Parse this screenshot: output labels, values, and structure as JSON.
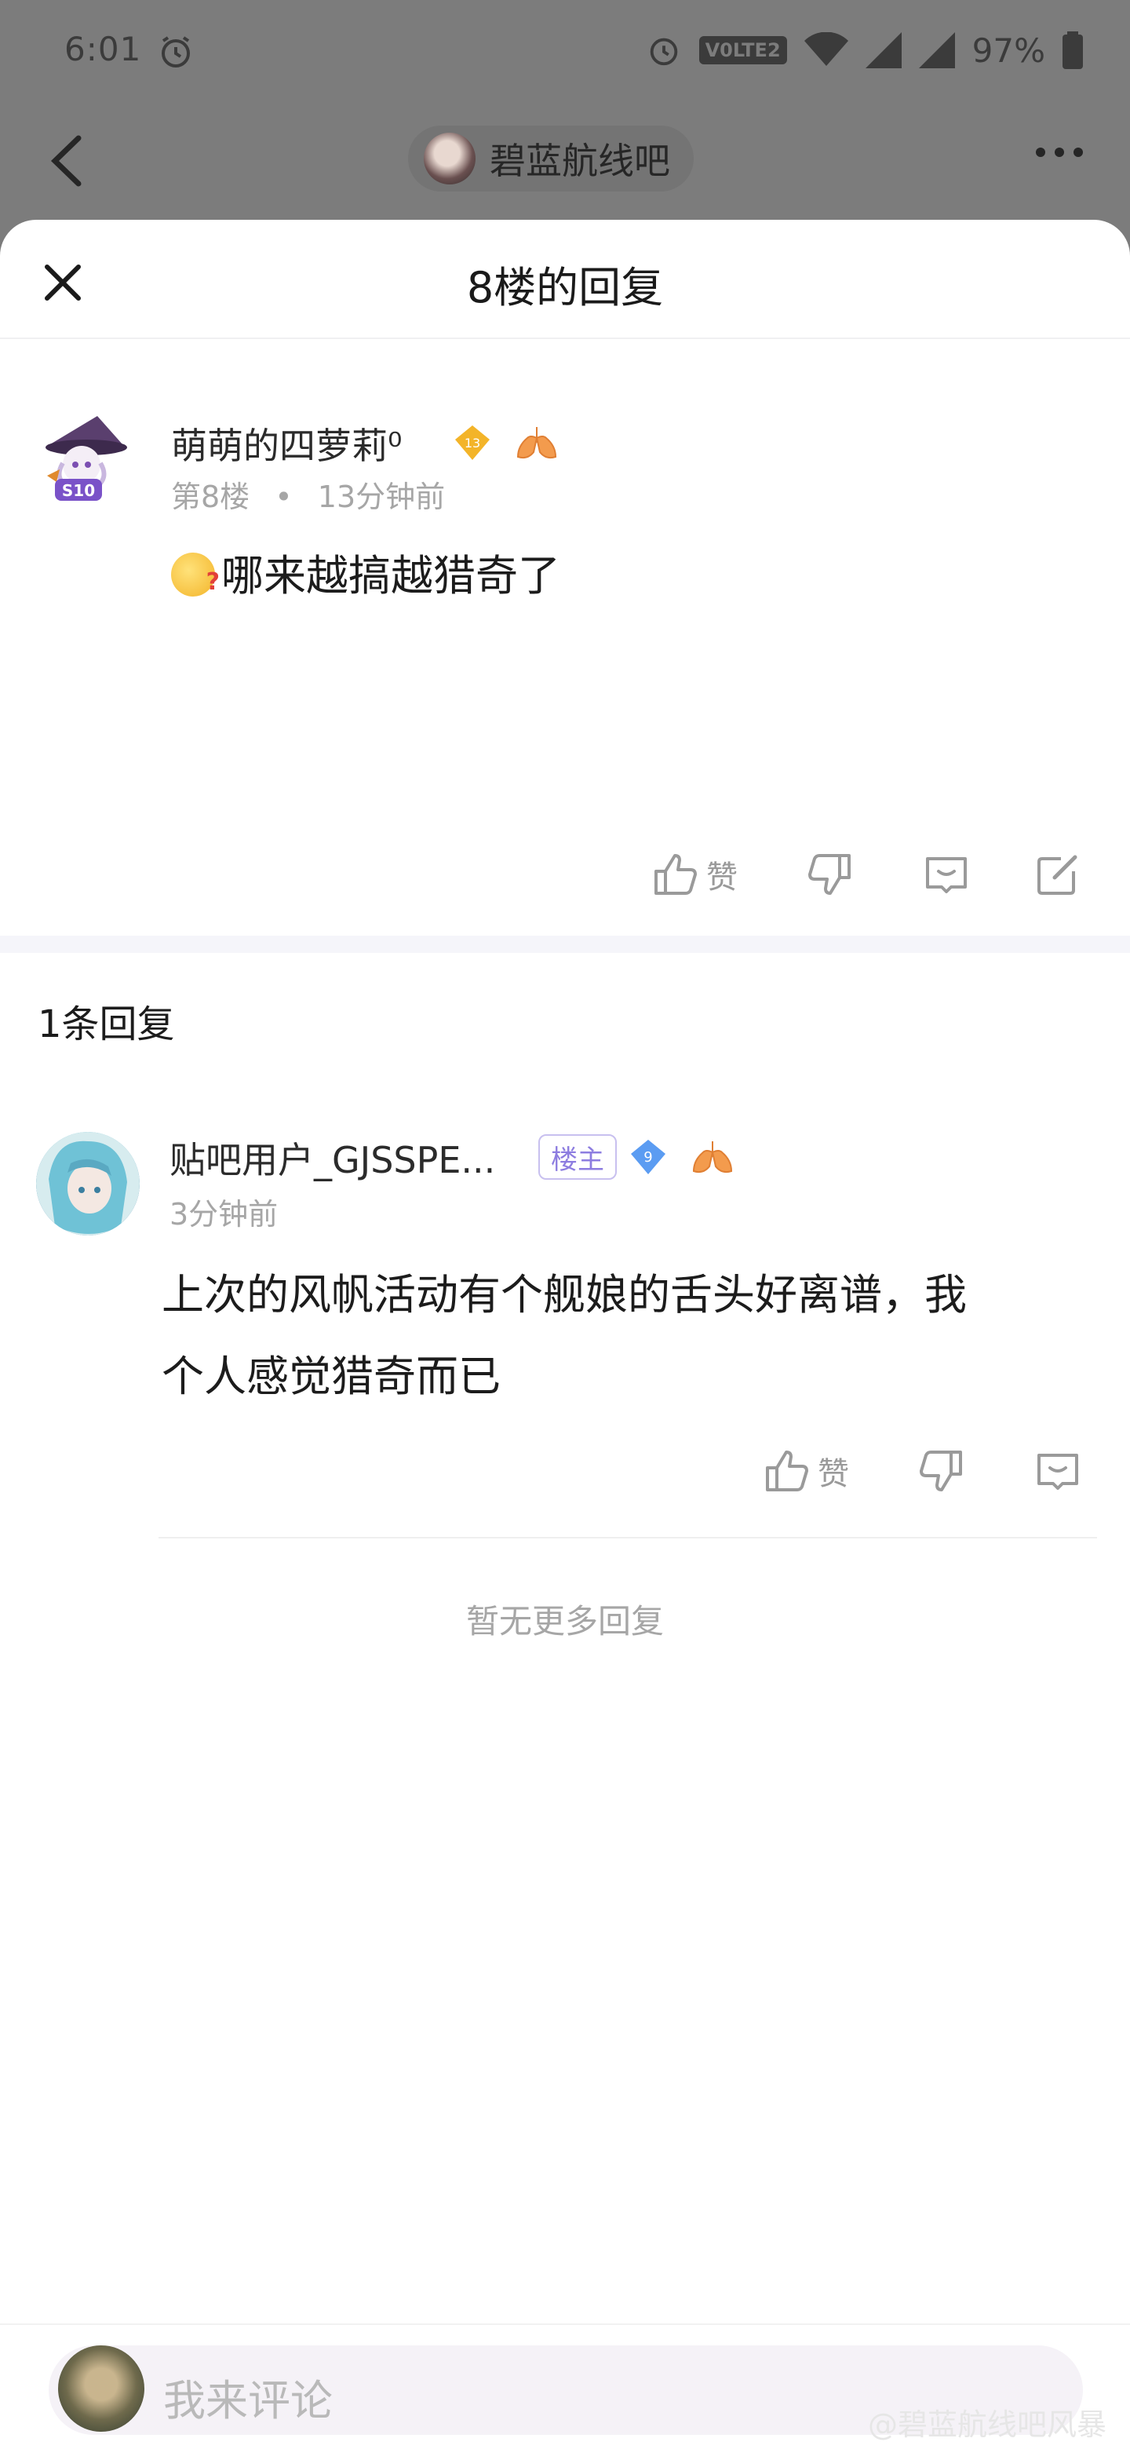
{
  "status_bar": {
    "time": "6:01",
    "network": "V0LTE2",
    "battery": "97%"
  },
  "header": {
    "forum_name": "碧蓝航线吧"
  },
  "sheet": {
    "title": "8楼的回复"
  },
  "floor_post": {
    "username": "萌萌的四萝莉⁰",
    "level": "13",
    "floor": "第8楼",
    "separator": "•",
    "time": "13分钟前",
    "content": "哪来越搞越猎奇了",
    "like_label": "赞"
  },
  "replies": {
    "count_label": "1条回复",
    "items": [
      {
        "username": "贴吧用户_GJSSPE...",
        "tag": "楼主",
        "level": "9",
        "time": "3分钟前",
        "content_line1": "上次的风帆活动有个舰娘的舌头好离谱，我",
        "content_line2": "个人感觉猎奇而已",
        "like_label": "赞"
      }
    ],
    "no_more": "暂无更多回复"
  },
  "comment_bar": {
    "placeholder": "我来评论",
    "watermark": "@碧蓝航线吧风暴"
  },
  "colors": {
    "accent_purple": "#8d7de0",
    "muted_text": "#a6a6a6",
    "diamond_gold": "#f3b429",
    "diamond_blue": "#5b9cf2"
  }
}
